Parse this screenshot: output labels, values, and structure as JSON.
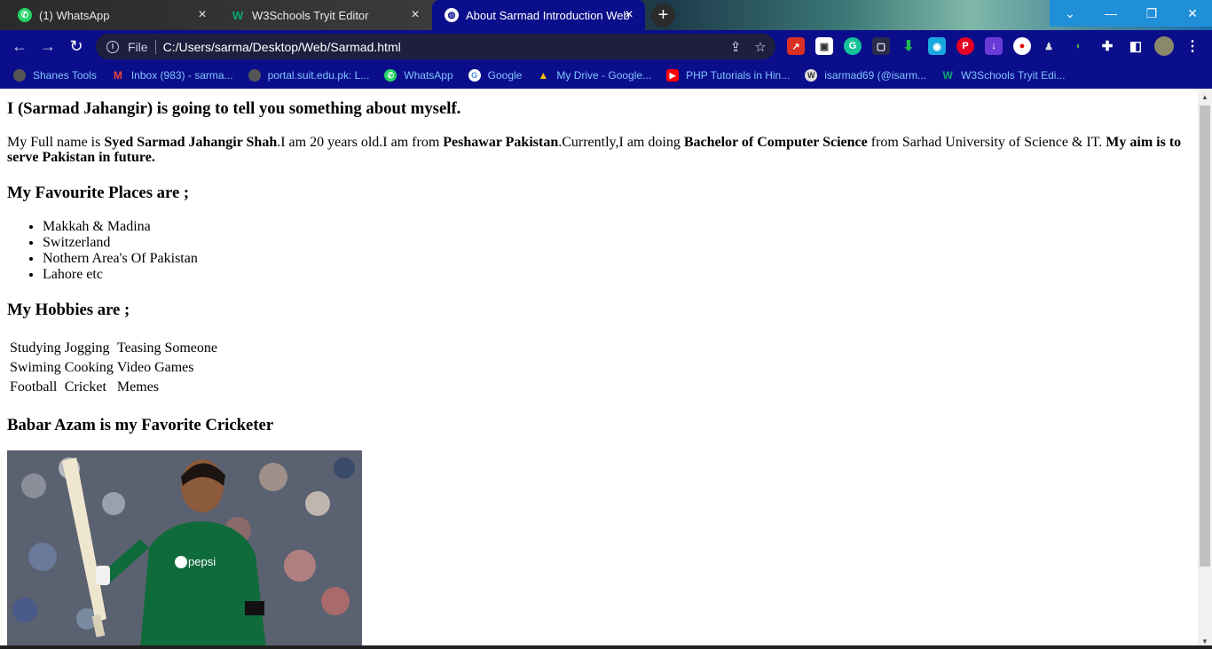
{
  "tabs": [
    {
      "title": "(1) WhatsApp",
      "icon": "whatsapp-icon",
      "active": false
    },
    {
      "title": "W3Schools Tryit Editor",
      "icon": "w3schools-icon",
      "active": false
    },
    {
      "title": "About Sarmad Introduction Web",
      "icon": "globe-icon",
      "active": true
    }
  ],
  "address_bar": {
    "scheme": "File",
    "url": "C:/Users/sarma/Desktop/Web/Sarmad.html"
  },
  "bookmarks": [
    {
      "label": "Shanes Tools",
      "icon": "globe-icon"
    },
    {
      "label": "Inbox (983) - sarma...",
      "icon": "gmail-icon"
    },
    {
      "label": "portal.suit.edu.pk: L...",
      "icon": "globe-icon"
    },
    {
      "label": "WhatsApp",
      "icon": "whatsapp-icon"
    },
    {
      "label": "Google",
      "icon": "google-icon"
    },
    {
      "label": "My Drive - Google...",
      "icon": "google-drive-icon"
    },
    {
      "label": "PHP Tutorials in Hin...",
      "icon": "youtube-icon"
    },
    {
      "label": "isarmad69 (@isarm...",
      "icon": "wordpress-icon"
    },
    {
      "label": "W3Schools Tryit Edi...",
      "icon": "w3schools-icon"
    }
  ],
  "page": {
    "heading_intro": "I (Sarmad Jahangir) is going to tell you something about myself.",
    "intro": {
      "t1": "My Full name is ",
      "b1": "Syed Sarmad Jahangir Shah",
      "t2": ".I am 20 years old.I am from ",
      "b2": "Peshawar Pakistan",
      "t3": ".Currently,I am doing ",
      "b3": "Bachelor of Computer Science",
      "t4": " from Sarhad University of Science & IT. ",
      "b4": "My aim is to serve Pakistan in future."
    },
    "heading_places": "My Favourite Places are ;",
    "places": [
      "Makkah & Madina",
      "Switzerland",
      "Nothern Area's Of Pakistan",
      "Lahore etc"
    ],
    "heading_hobbies": "My Hobbies are ;",
    "hobbies": [
      [
        "Studying",
        "Jogging",
        "Teasing Someone"
      ],
      [
        "Swiming",
        "Cooking",
        "Video Games"
      ],
      [
        "Football",
        "Cricket",
        "Memes"
      ]
    ],
    "heading_cricketer": "Babar Azam is my Favorite Cricketer",
    "photo_jersey_text": "pepsi"
  },
  "colors": {
    "browser_frame": "#0b0e8a",
    "bookmark_text": "#7fc4ff",
    "omnibox_bg": "#1e1f3e"
  }
}
